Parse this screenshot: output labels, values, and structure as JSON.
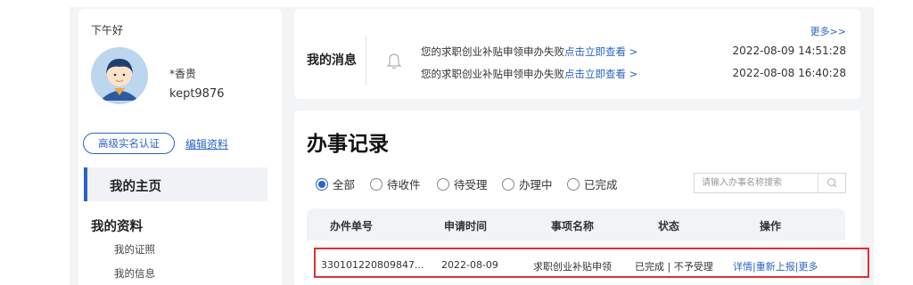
{
  "sidebar": {
    "greeting": "下午好",
    "user_name": "*香贵",
    "user_id": "kept9876",
    "verify_button": "高级实名认证",
    "edit_link": "编辑资料",
    "home_item": "我的主页",
    "profile_heading": "我的资料",
    "profile_items": [
      "我的证照",
      "我的信息"
    ]
  },
  "messages": {
    "title": "我的消息",
    "more": "更多>>",
    "items": [
      {
        "text": "您的求职创业补贴申领申办失败",
        "link": "点击立即查看 >",
        "time": "2022-08-09 14:51:28"
      },
      {
        "text": "您的求职创业补贴申领申办失败",
        "link": "点击立即查看 >",
        "time": "2022-08-08 16:40:28"
      }
    ]
  },
  "records": {
    "title": "办事记录",
    "filters": [
      {
        "label": "全部",
        "checked": true
      },
      {
        "label": "待收件",
        "checked": false
      },
      {
        "label": "待受理",
        "checked": false
      },
      {
        "label": "办理中",
        "checked": false
      },
      {
        "label": "已完成",
        "checked": false
      }
    ],
    "search_placeholder": "请输入办事名称搜索",
    "columns": [
      "办件单号",
      "申请时间",
      "事项名称",
      "状态",
      "操作"
    ],
    "rows": [
      {
        "id": "330101220809847...",
        "date": "2022-08-09",
        "name": "求职创业补贴申领",
        "status": "已完成 | 不予受理",
        "ops": [
          "详情",
          "重新上报",
          "更多"
        ]
      }
    ]
  },
  "colors": {
    "accent": "#2a64c5",
    "highlight": "#e03030"
  }
}
